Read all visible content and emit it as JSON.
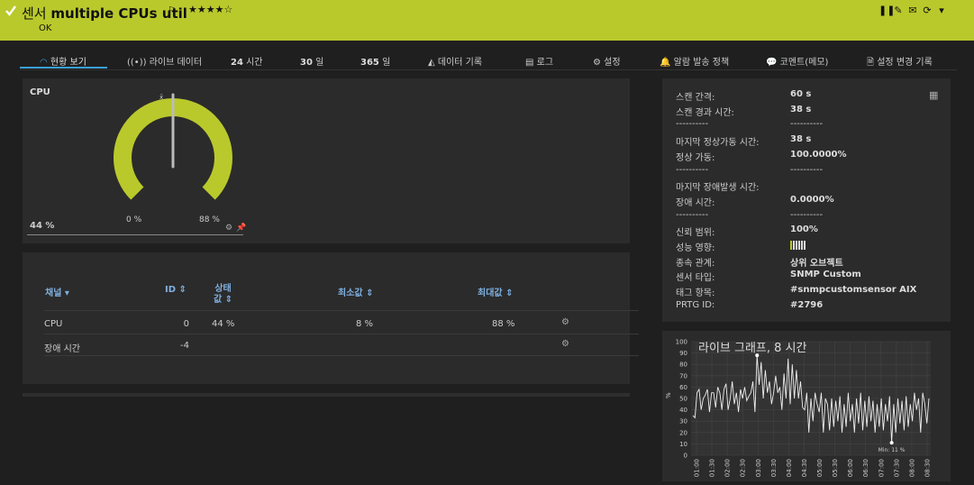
{
  "header": {
    "prefix": "센서",
    "sensor_name": "multiple CPUs util",
    "stars": "★★★★☆",
    "status": "OK"
  },
  "tabs": [
    {
      "label": "현황 보기"
    },
    {
      "label": "라이브 데이터"
    },
    {
      "num": "24",
      "label": "시간"
    },
    {
      "num": "30",
      "label": "일"
    },
    {
      "num": "365",
      "label": "일"
    },
    {
      "label": "데이터 기록"
    },
    {
      "label": "로그"
    },
    {
      "label": "설정"
    },
    {
      "label": "알람 발송 정책"
    },
    {
      "label": "코멘트(메모)"
    },
    {
      "label": "설정 변경 기록"
    }
  ],
  "gauge": {
    "title": "CPU",
    "value": "44 %",
    "min_label": "0 %",
    "max_label": "88 %",
    "needle_value": 44,
    "range_max": 88
  },
  "table": {
    "headers": {
      "channel": "채널",
      "id": "ID",
      "state": "상태\n값",
      "min": "최소값",
      "max": "최대값"
    },
    "rows": [
      {
        "channel": "CPU",
        "id": "0",
        "state": "44 %",
        "min": "8 %",
        "max": "88 %"
      },
      {
        "channel": "장애 시간",
        "id": "-4",
        "state": "",
        "min": "",
        "max": ""
      }
    ]
  },
  "info": [
    {
      "k": "스캔 간격:",
      "v": "60 s"
    },
    {
      "k": "스캔 경과 시간:",
      "v": "38 s"
    },
    {
      "k": "----------",
      "v": "----------",
      "sep": true
    },
    {
      "k": "마지막 정상가동 시간:",
      "v": "38 s"
    },
    {
      "k": "정상 가동:",
      "v": "100.0000%"
    },
    {
      "k": "----------",
      "v": "----------",
      "sep": true
    },
    {
      "k": "마지막 장애발생 시간:",
      "v": ""
    },
    {
      "k": "장애 시간:",
      "v": "0.0000%"
    },
    {
      "k": "----------",
      "v": "----------",
      "sep": true
    },
    {
      "k": "신뢰 범위:",
      "v": "100%"
    },
    {
      "k": "성능 영향:",
      "v": ""
    },
    {
      "k": "종속 관계:",
      "v": "상위 오브젝트"
    },
    {
      "k": "센서 타입:",
      "v": "SNMP Custom"
    },
    {
      "k": "태그 항목:",
      "v": "#snmpcustomsensor AIX"
    },
    {
      "k": "PRTG ID:",
      "v": "#2796"
    }
  ],
  "performance_impact": {
    "filled": 1,
    "total": 6
  },
  "chart_data": {
    "type": "line",
    "title": "라이브 그래프, 8 시간",
    "ylabel": "%",
    "ylim": [
      0,
      100
    ],
    "yticks": [
      0,
      10,
      20,
      30,
      40,
      50,
      60,
      70,
      80,
      90,
      100
    ],
    "xticks": [
      "01:00",
      "01:30",
      "02:00",
      "02:30",
      "03:00",
      "03:30",
      "04:00",
      "04:30",
      "05:00",
      "05:30",
      "06:00",
      "06:30",
      "07:00",
      "07:30",
      "08:00",
      "08:30"
    ],
    "min_annotation": "Min: 11 %",
    "series": [
      {
        "values": [
          35,
          33,
          55,
          58,
          40,
          50,
          53,
          58,
          38,
          55,
          55,
          42,
          60,
          55,
          40,
          58,
          63,
          40,
          50,
          65,
          45,
          55,
          38,
          58,
          50,
          60,
          48,
          52,
          55,
          65,
          38,
          88,
          62,
          82,
          50,
          75,
          55,
          65,
          45,
          55,
          70,
          55,
          60,
          40,
          72,
          50,
          85,
          45,
          80,
          50,
          75,
          50,
          65,
          42,
          40,
          55,
          20,
          50,
          30,
          55,
          45,
          38,
          55,
          20,
          50,
          45,
          22,
          50,
          25,
          48,
          30,
          52,
          20,
          45,
          25,
          55,
          30,
          45,
          20,
          50,
          28,
          55,
          22,
          48,
          25,
          52,
          30,
          48,
          20,
          45,
          25,
          50,
          22,
          45,
          30,
          52,
          11,
          45,
          20,
          50,
          28,
          48,
          22,
          52,
          25,
          45,
          30,
          55,
          40,
          50,
          20,
          55,
          45,
          28,
          50
        ]
      }
    ]
  }
}
